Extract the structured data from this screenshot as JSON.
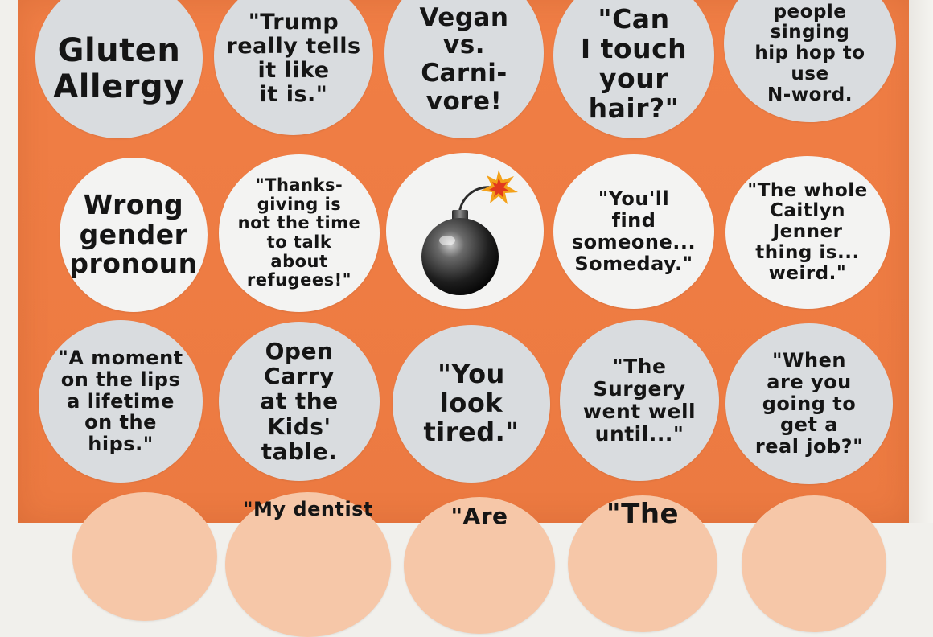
{
  "bingo_board": {
    "rows": [
      [
        {
          "text": "Gluten\nAllergy"
        },
        {
          "text": "\"Trump\nreally tells\nit like\nit is.\""
        },
        {
          "text": "Vegan\nvs.\nCarni-\nvore!"
        },
        {
          "text": "\"Can\nI touch\nyour\nhair?\""
        },
        {
          "text": "people\nsinging\nhip hop to\nuse\nN-word."
        }
      ],
      [
        {
          "text": "Wrong\ngender\npronoun"
        },
        {
          "text": "\"Thanks-\ngiving is\nnot the time\nto talk\nabout\nrefugees!\""
        },
        {
          "icon": "bomb-icon"
        },
        {
          "text": "\"You'll\nfind\nsomeone...\nSomeday.\""
        },
        {
          "text": "\"The whole\nCaitlyn\nJenner\nthing is...\nweird.\""
        }
      ],
      [
        {
          "text": "\"A moment\non the lips\na lifetime\non the\nhips.\""
        },
        {
          "text": "Open\nCarry\nat the\nKids'\ntable."
        },
        {
          "text": "\"You\nlook\ntired.\""
        },
        {
          "text": "\"The\nSurgery\nwent well\nuntil...\""
        },
        {
          "text": "\"When\nare you\ngoing to\nget a\nreal job?\""
        }
      ],
      [
        {
          "text": ""
        },
        {
          "text": "\"My dentist"
        },
        {
          "text": "\"Are"
        },
        {
          "text": "\"The"
        },
        {
          "text": ""
        }
      ]
    ]
  },
  "colors": {
    "board": "#ef7d44",
    "circle_gray": "#d9dcdf",
    "circle_white": "#f3f3f2",
    "circle_peach": "#f6c7a8",
    "ink": "#151515"
  }
}
